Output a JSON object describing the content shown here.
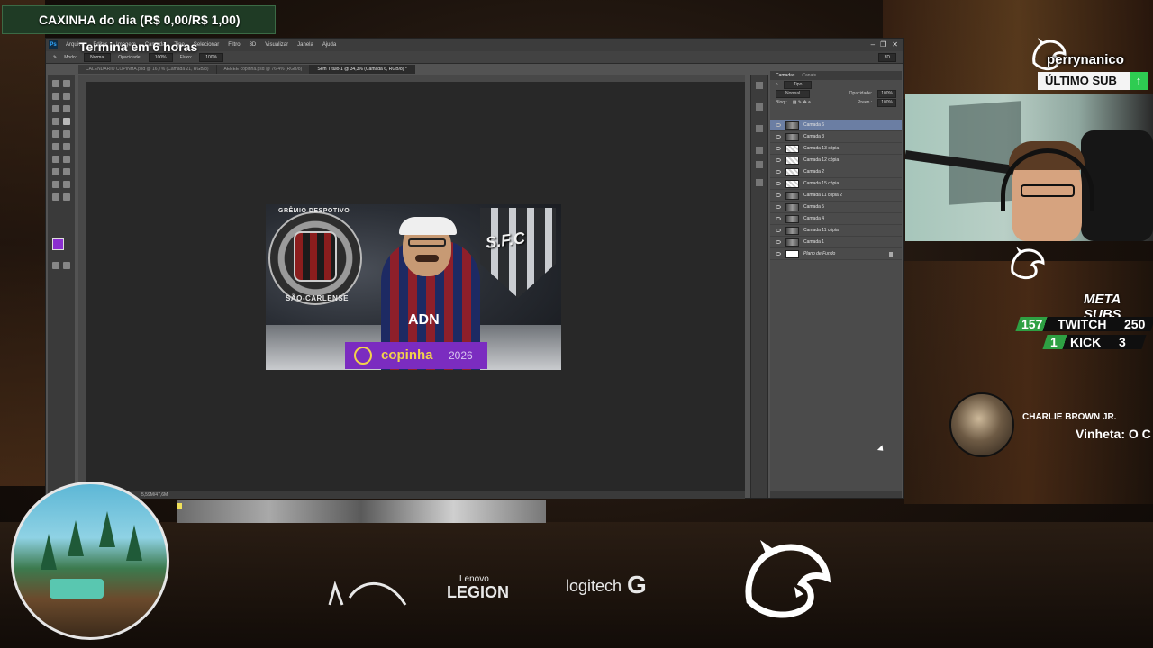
{
  "overlay": {
    "goal": {
      "label": "CAXINHA do dia (R$ 0,00/R$ 1,00)",
      "progress": 0.0,
      "subtitle": "Termina em 6 horas"
    },
    "latest_sub": {
      "name": "perrynanico",
      "tag": "ÚLTIMO SUB",
      "arrow": "↑"
    },
    "meta_subs": {
      "title": "META SUBS",
      "rows": [
        {
          "current": "157",
          "platform": "TWITCH",
          "goal": "250"
        },
        {
          "current": "1",
          "platform": "KICK",
          "goal": "3"
        }
      ]
    },
    "now_playing": {
      "artist": "CHARLIE BROWN JR.",
      "title": "Vinheta: O C"
    },
    "sponsors": {
      "logitech": "logitech",
      "logitech_g": "G",
      "lenovo": "Lenovo",
      "legion": "LEGION"
    },
    "colors": {
      "accent_green": "#2ea043",
      "tag_green": "#2ecc52",
      "copinha_purple": "#7b2cc0"
    }
  },
  "photoshop": {
    "logo": "Ps",
    "menus": [
      "Arquivo",
      "Editar",
      "Imagem",
      "Camada",
      "Tipo",
      "Selecionar",
      "Filtro",
      "3D",
      "Visualizar",
      "Janela",
      "Ajuda"
    ],
    "window_controls": [
      "–",
      "❐",
      "✕"
    ],
    "options": {
      "mode_label": "Modo:",
      "mode_value": "Normal",
      "opacity_label": "Opacidade:",
      "opacity_value": "100%",
      "flow_label": "Fluxo:",
      "flow_value": "100%",
      "workspace": "3D"
    },
    "tabs": [
      {
        "label": "CALENDARIO COPINHA.psd @ 16,7% (Camada 21, RGB/8)",
        "active": false
      },
      {
        "label": "AEEEE copinha.psd @ 76,4% (RGB/8)",
        "active": false
      },
      {
        "label": "Sem Título-1 @ 34,3% (Camada 6, RGB/8) *",
        "active": true
      }
    ],
    "status": "5,59M/47,6M",
    "layers_panel": {
      "tabs": [
        "Camadas",
        "Canais"
      ],
      "filter": "Tipo",
      "blend": "Normal",
      "opacity_label": "Opacidade:",
      "opacity": "100%",
      "lock_label": "Bloq.:",
      "fill_label": "Preen.:",
      "fill": "100%",
      "layers": [
        {
          "name": "Camada 6",
          "thumb": "img",
          "selected": true
        },
        {
          "name": "Camada 3",
          "thumb": "img",
          "selected": false
        },
        {
          "name": "Camada 13 cópia",
          "thumb": "checker",
          "selected": false
        },
        {
          "name": "Camada 12 cópia",
          "thumb": "checker",
          "selected": false
        },
        {
          "name": "Camada 2",
          "thumb": "checker",
          "selected": false
        },
        {
          "name": "Camada 15 cópia",
          "thumb": "checker",
          "selected": false
        },
        {
          "name": "Camada 11 cópia 2",
          "thumb": "img",
          "selected": false
        },
        {
          "name": "Camada 5",
          "thumb": "img",
          "selected": false
        },
        {
          "name": "Camada 4",
          "thumb": "img",
          "selected": false
        },
        {
          "name": "Camada 11 cópia",
          "thumb": "img",
          "selected": false
        },
        {
          "name": "Camada 1",
          "thumb": "img",
          "selected": false
        },
        {
          "name": "Plano de Fundo",
          "thumb": "white",
          "selected": false
        }
      ]
    }
  },
  "artwork": {
    "crest_top": "GRÊMIO DESPOTIVO",
    "crest_bottom": "SÃO-CARLENSE",
    "shield": "S.F.C",
    "jersey": "ADN",
    "banner_text": "copinha",
    "banner_year": "2026"
  }
}
